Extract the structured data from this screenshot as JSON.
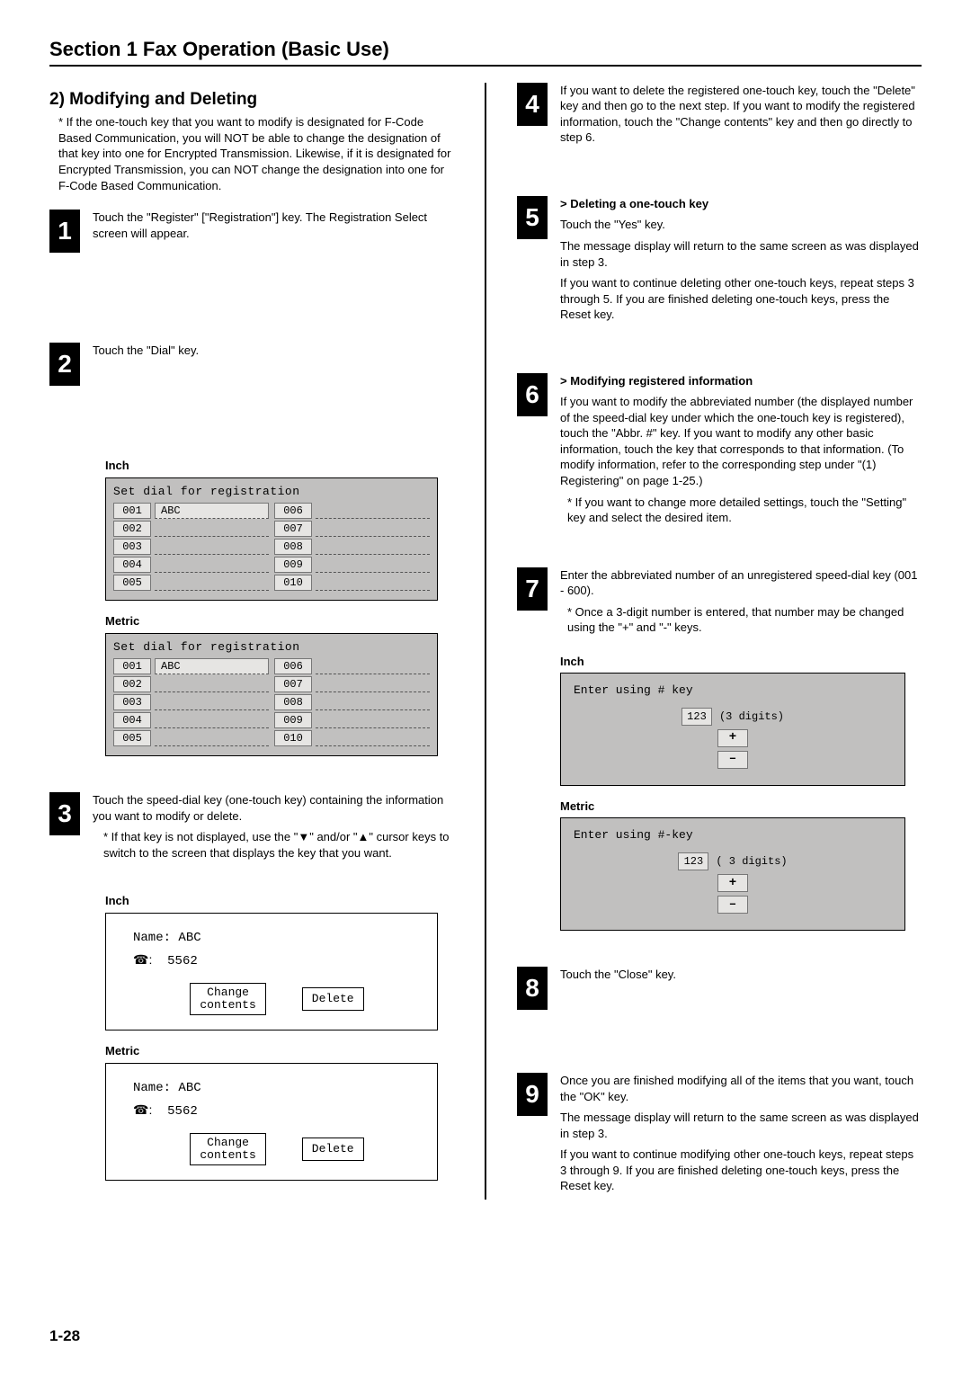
{
  "header": {
    "section": "Section 1  Fax Operation (Basic Use)"
  },
  "left": {
    "subtitle": "2) Modifying and Deleting",
    "intro": "* If the one-touch key that you want to modify is designated for F-Code Based Communication, you will NOT be able to change the designation of that key into one for Encrypted Transmission. Likewise, if it is designated for Encrypted Transmission, you can NOT change the designation into one for F-Code Based Communication.",
    "step1": {
      "num": "1",
      "text": "Touch the \"Register\" [\"Registration\"] key. The Registration Select screen will appear."
    },
    "step2": {
      "num": "2",
      "text": "Touch the \"Dial\" key.",
      "inch_label": "Inch",
      "metric_label": "Metric",
      "dial_header": "Set dial for registration",
      "left_nums": [
        "001",
        "002",
        "003",
        "004",
        "005"
      ],
      "right_nums": [
        "006",
        "007",
        "008",
        "009",
        "010"
      ],
      "first_val": "ABC"
    },
    "step3": {
      "num": "3",
      "p1": "Touch the speed-dial key (one-touch key) containing the information you want to modify or delete.",
      "p2": "* If that key is not displayed, use the \"▼\" and/or \"▲\" cursor keys to switch to the screen that displays the key that you want.",
      "inch_label": "Inch",
      "metric_label": "Metric",
      "name_label": "Name:",
      "name_val": "ABC",
      "tel_label": "☎:",
      "tel_val": "5562",
      "btn_change_l1": "Change",
      "btn_change_l2": "contents",
      "btn_delete": "Delete"
    }
  },
  "right": {
    "step4": {
      "num": "4",
      "text": "If you want to delete the registered one-touch key, touch the \"Delete\" key and then go to the next step. If you want to modify the registered information, touch the \"Change contents\" key and then go directly to step 6."
    },
    "step5": {
      "num": "5",
      "hdr": "> Deleting a one-touch key",
      "p1": "Touch the \"Yes\" key.",
      "p2": "The message display will return to the same screen as was displayed in step 3.",
      "p3": "If you want to continue deleting other one-touch keys, repeat steps 3 through 5. If you are finished deleting one-touch keys, press the Reset key."
    },
    "step6": {
      "num": "6",
      "hdr": "> Modifying registered information",
      "p1": "If you want to modify the abbreviated number (the displayed number of the speed-dial key under which the one-touch key is registered), touch the \"Abbr. #\" key. If you want to modify any other basic information, touch the key that corresponds to that information. (To modify information, refer to the corresponding step under \"(1) Registering\" on page 1-25.)",
      "p2": "* If you want to change more detailed settings, touch the \"Setting\" key and select the desired item."
    },
    "step7": {
      "num": "7",
      "p1": "Enter the abbreviated number of an unregistered speed-dial key (001 - 600).",
      "p2": "* Once a 3-digit number is entered, that number may be changed using the \"+\" and \"-\" keys.",
      "inch_label": "Inch",
      "metric_label": "Metric",
      "enter_hdr_inch": "Enter using # key",
      "enter_hdr_metric": "Enter using #-key",
      "numbox": "123",
      "digits_inch": "(3 digits)",
      "digits_metric": "( 3 digits)",
      "plus": "+",
      "minus": "–"
    },
    "step8": {
      "num": "8",
      "text": "Touch the \"Close\" key."
    },
    "step9": {
      "num": "9",
      "p1": "Once you are finished modifying all of the items that you want, touch the \"OK\" key.",
      "p2": "The message display will return to the same screen as was displayed in step 3.",
      "p3": "If you want to continue modifying other one-touch keys, repeat steps 3 through 9. If you are finished deleting one-touch keys, press the Reset key."
    }
  },
  "footer": "1-28"
}
